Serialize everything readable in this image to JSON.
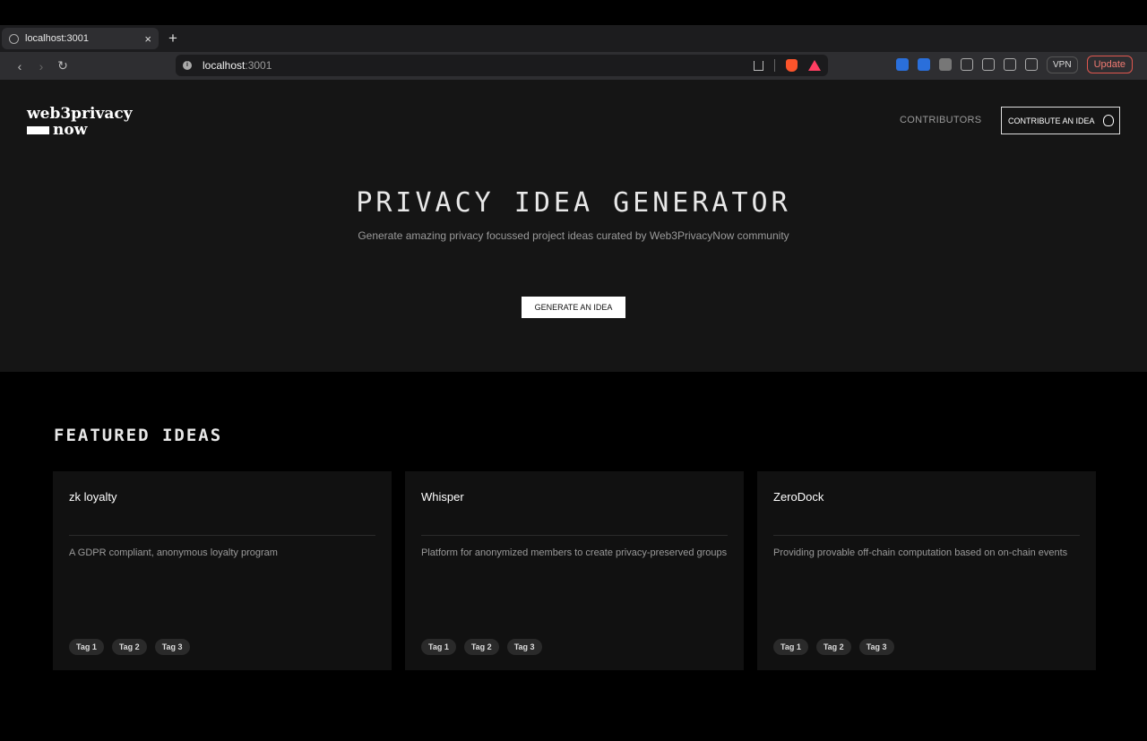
{
  "browser": {
    "tab_title": "localhost:3001",
    "tab_close": "×",
    "new_tab": "+",
    "url_host": "localhost",
    "url_port": ":3001",
    "vpn_label": "VPN",
    "update_label": "Update"
  },
  "site": {
    "logo_line1": "web3privacy",
    "logo_line2": "now",
    "nav_contributors": "CONTRIBUTORS",
    "nav_contribute": "CONTRIBUTE AN IDEA"
  },
  "hero": {
    "title": "PRIVACY IDEA GENERATOR",
    "subtitle": "Generate amazing privacy focussed project ideas curated by Web3PrivacyNow community",
    "button": "GENERATE AN IDEA"
  },
  "featured": {
    "title": "FEATURED IDEAS",
    "cards": [
      {
        "title": "zk loyalty",
        "description": "A GDPR compliant, anonymous loyalty program",
        "tags": [
          "Tag 1",
          "Tag 2",
          "Tag 3"
        ]
      },
      {
        "title": "Whisper",
        "description": "Platform for anonymized members to create privacy-preserved groups",
        "tags": [
          "Tag 1",
          "Tag 2",
          "Tag 3"
        ]
      },
      {
        "title": "ZeroDock",
        "description": "Providing provable off-chain computation based on on-chain events",
        "tags": [
          "Tag 1",
          "Tag 2",
          "Tag 3"
        ]
      }
    ]
  }
}
